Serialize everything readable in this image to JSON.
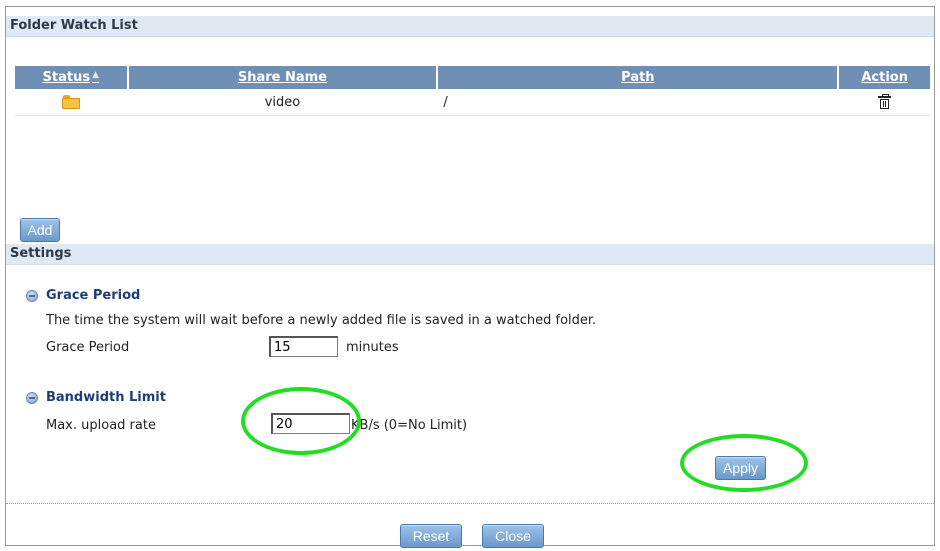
{
  "folder_watch": {
    "title": "Folder Watch List",
    "columns": {
      "status": "Status",
      "share_name": "Share Name",
      "path": "Path",
      "action": "Action"
    },
    "status_sort_icon": "sort-up-arrow-icon",
    "rows": [
      {
        "status_icon": "folder-icon",
        "share_name": "video",
        "path": "/",
        "action_icon": "trash-icon"
      }
    ],
    "add_label": "Add"
  },
  "settings": {
    "title": "Settings",
    "grace": {
      "heading": "Grace Period",
      "description": "The time the system will wait before a newly added file is saved in a watched folder.",
      "label": "Grace Period",
      "value": "15",
      "unit": "minutes"
    },
    "bandwidth": {
      "heading": "Bandwidth Limit",
      "label": "Max. upload rate",
      "value": "20",
      "unit": "KB/s (0=No Limit)"
    },
    "apply_label": "Apply"
  },
  "footer": {
    "reset_label": "Reset",
    "close_label": "Close"
  },
  "colors": {
    "header_bar": "#dfe9f3",
    "table_header": "#6f8fb4",
    "highlight_circle": "#22dd22",
    "button": "#7fa7d6"
  }
}
